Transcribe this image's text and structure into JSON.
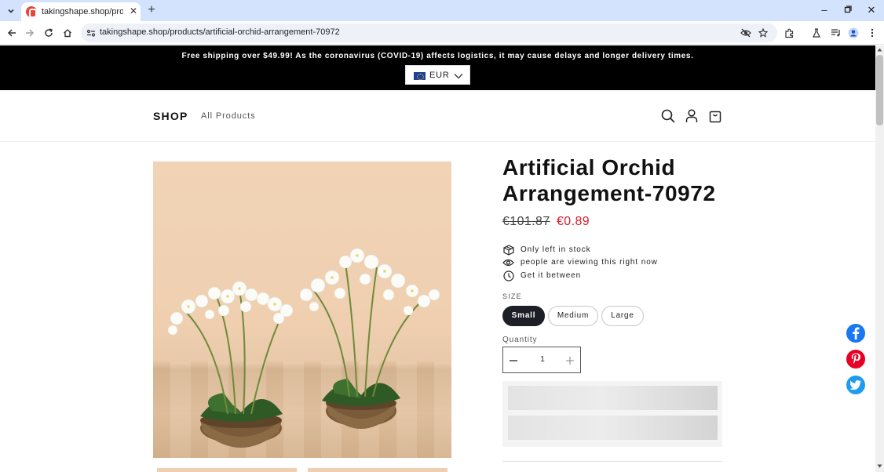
{
  "browser": {
    "tab_title": "takingshape.shop/products/arti",
    "url": "takingshape.shop/products/artificial-orchid-arrangement-70972",
    "icons": [
      "tab-search-icon",
      "favicon",
      "close-icon",
      "new-tab-icon",
      "minimize-icon",
      "restore-icon",
      "close-window-icon",
      "back-icon",
      "forward-icon",
      "reload-icon",
      "home-icon",
      "site-info-icon",
      "eye-off-icon",
      "star-icon",
      "extensions-icon",
      "labs-icon",
      "media-icon",
      "profile-icon",
      "menu-icon"
    ]
  },
  "announcement": {
    "text": "Free shipping over $49.99! As the coronavirus (COVID-19) affects logistics, it may cause delays and longer delivery times.",
    "currency": "EUR"
  },
  "header": {
    "logo": "SHOP",
    "nav": [
      "All Products"
    ],
    "icons": [
      "search-icon",
      "account-icon",
      "cart-icon"
    ]
  },
  "product": {
    "title": "Artificial Orchid Arrangement-70972",
    "price_compare": "€101.87",
    "price_sale": "€0.89",
    "info": [
      {
        "icon": "box-icon",
        "text": "Only left in stock"
      },
      {
        "icon": "eye-icon",
        "text": "people are viewing this right now"
      },
      {
        "icon": "clock-icon",
        "text": "Get it between"
      }
    ],
    "size_label": "SIZE",
    "sizes": [
      "Small",
      "Medium",
      "Large"
    ],
    "selected_size": "Small",
    "quantity_label": "Quantity",
    "quantity_value": "1"
  },
  "social": [
    {
      "name": "facebook",
      "glyph": "f",
      "color": "#1877f2"
    },
    {
      "name": "pinterest",
      "glyph": "P",
      "color": "#e60023"
    },
    {
      "name": "twitter",
      "glyph": "t",
      "color": "#1d9bf0"
    }
  ],
  "colors": {
    "announce_bg": "#000000",
    "sale_price": "#d91c2b",
    "selected_pill": "#1c1f26"
  }
}
